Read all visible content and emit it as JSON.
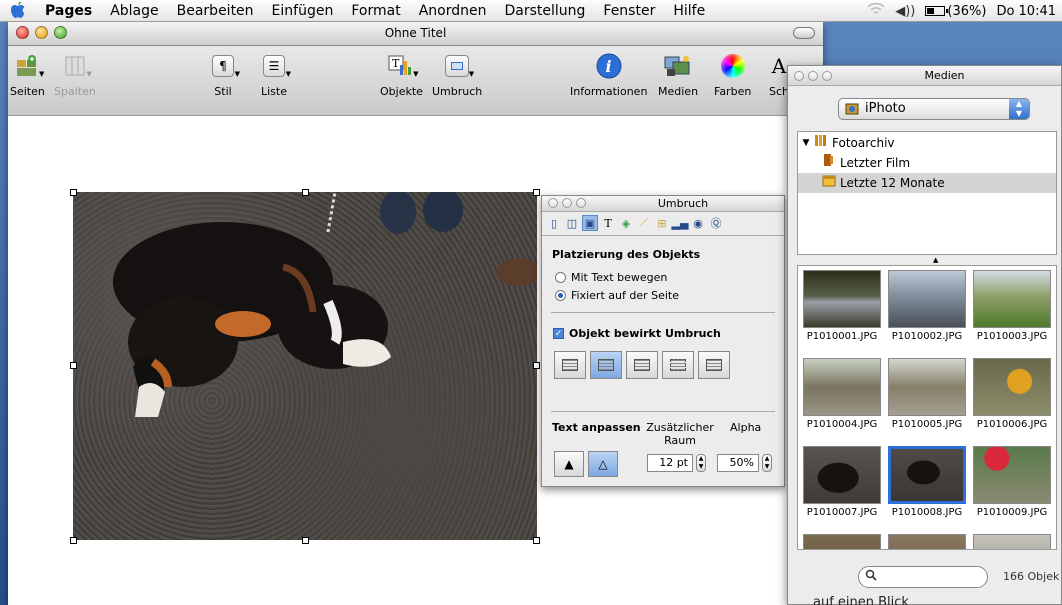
{
  "menubar": {
    "app": "Pages",
    "items": [
      "Ablage",
      "Bearbeiten",
      "Einfügen",
      "Format",
      "Anordnen",
      "Darstellung",
      "Fenster",
      "Hilfe"
    ],
    "battery_text": "(36%)",
    "battery_level": 0.36,
    "clock": "Do 10:41"
  },
  "window": {
    "title": "Ohne Titel",
    "toolbar": {
      "seiten": "Seiten",
      "spalten": "Spalten",
      "stil": "Stil",
      "liste": "Liste",
      "objekte": "Objekte",
      "umbruch": "Umbruch",
      "informationen": "Informationen",
      "medien": "Medien",
      "farben": "Farben",
      "schrift": "Sch"
    }
  },
  "umbruch": {
    "title": "Umbruch",
    "placement_heading": "Platzierung des Objekts",
    "radio_move": "Mit Text bewegen",
    "radio_fixed": "Fixiert auf der Seite",
    "wrap_checkbox": "Objekt bewirkt Umbruch",
    "text_fit": "Text anpassen",
    "extra_space": "Zusätzlicher Raum",
    "alpha": "Alpha",
    "space_value": "12 pt",
    "alpha_value": "50%"
  },
  "medien": {
    "title": "Medien",
    "source": "iPhoto",
    "tree": [
      "Fotoarchiv",
      "Letzter Film",
      "Letzte 12 Monate"
    ],
    "photos": [
      "P1010001.JPG",
      "P1010002.JPG",
      "P1010003.JPG",
      "P1010004.JPG",
      "P1010005.JPG",
      "P1010006.JPG",
      "P1010007.JPG",
      "P1010008.JPG",
      "P1010009.JPG"
    ],
    "count": "166 Objek",
    "bottom_text": "auf einen Blick"
  },
  "colors": {
    "accent": "#2d6fd6",
    "selection": "#9bbce8"
  }
}
